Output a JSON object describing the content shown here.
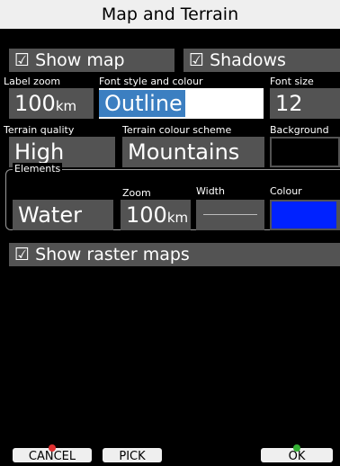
{
  "window": {
    "title": "Map and Terrain"
  },
  "show_map": {
    "label": "☑ Show map"
  },
  "shadows": {
    "label": "☑ Shadows"
  },
  "label_zoom": {
    "label": "Label zoom",
    "value": "100",
    "unit": "km"
  },
  "font_style": {
    "label": "Font style and colour",
    "value": "Outline"
  },
  "font_size": {
    "label": "Font size",
    "value": "12"
  },
  "terrain_quality": {
    "label": "Terrain quality",
    "value": "High"
  },
  "terrain_scheme": {
    "label": "Terrain colour scheme",
    "value": "Mountains"
  },
  "background": {
    "label": "Background",
    "value": ""
  },
  "elements": {
    "legend": "Elements",
    "zoom_label": "Zoom",
    "width_label": "Width",
    "colour_label": "Colour",
    "element_value": "Water",
    "zoom_value": "100",
    "zoom_unit": "km",
    "colour_hex": "#0022ff"
  },
  "show_raster": {
    "label": "☑ Show raster maps"
  },
  "buttons": {
    "cancel": "CANCEL",
    "pick": "PICK",
    "ok": "OK"
  },
  "colors": {
    "bar": "#535353",
    "title_bg": "#efefef",
    "selection": "#3c7fc1",
    "cancel_dot": "#e03030",
    "ok_dot": "#33b033"
  }
}
